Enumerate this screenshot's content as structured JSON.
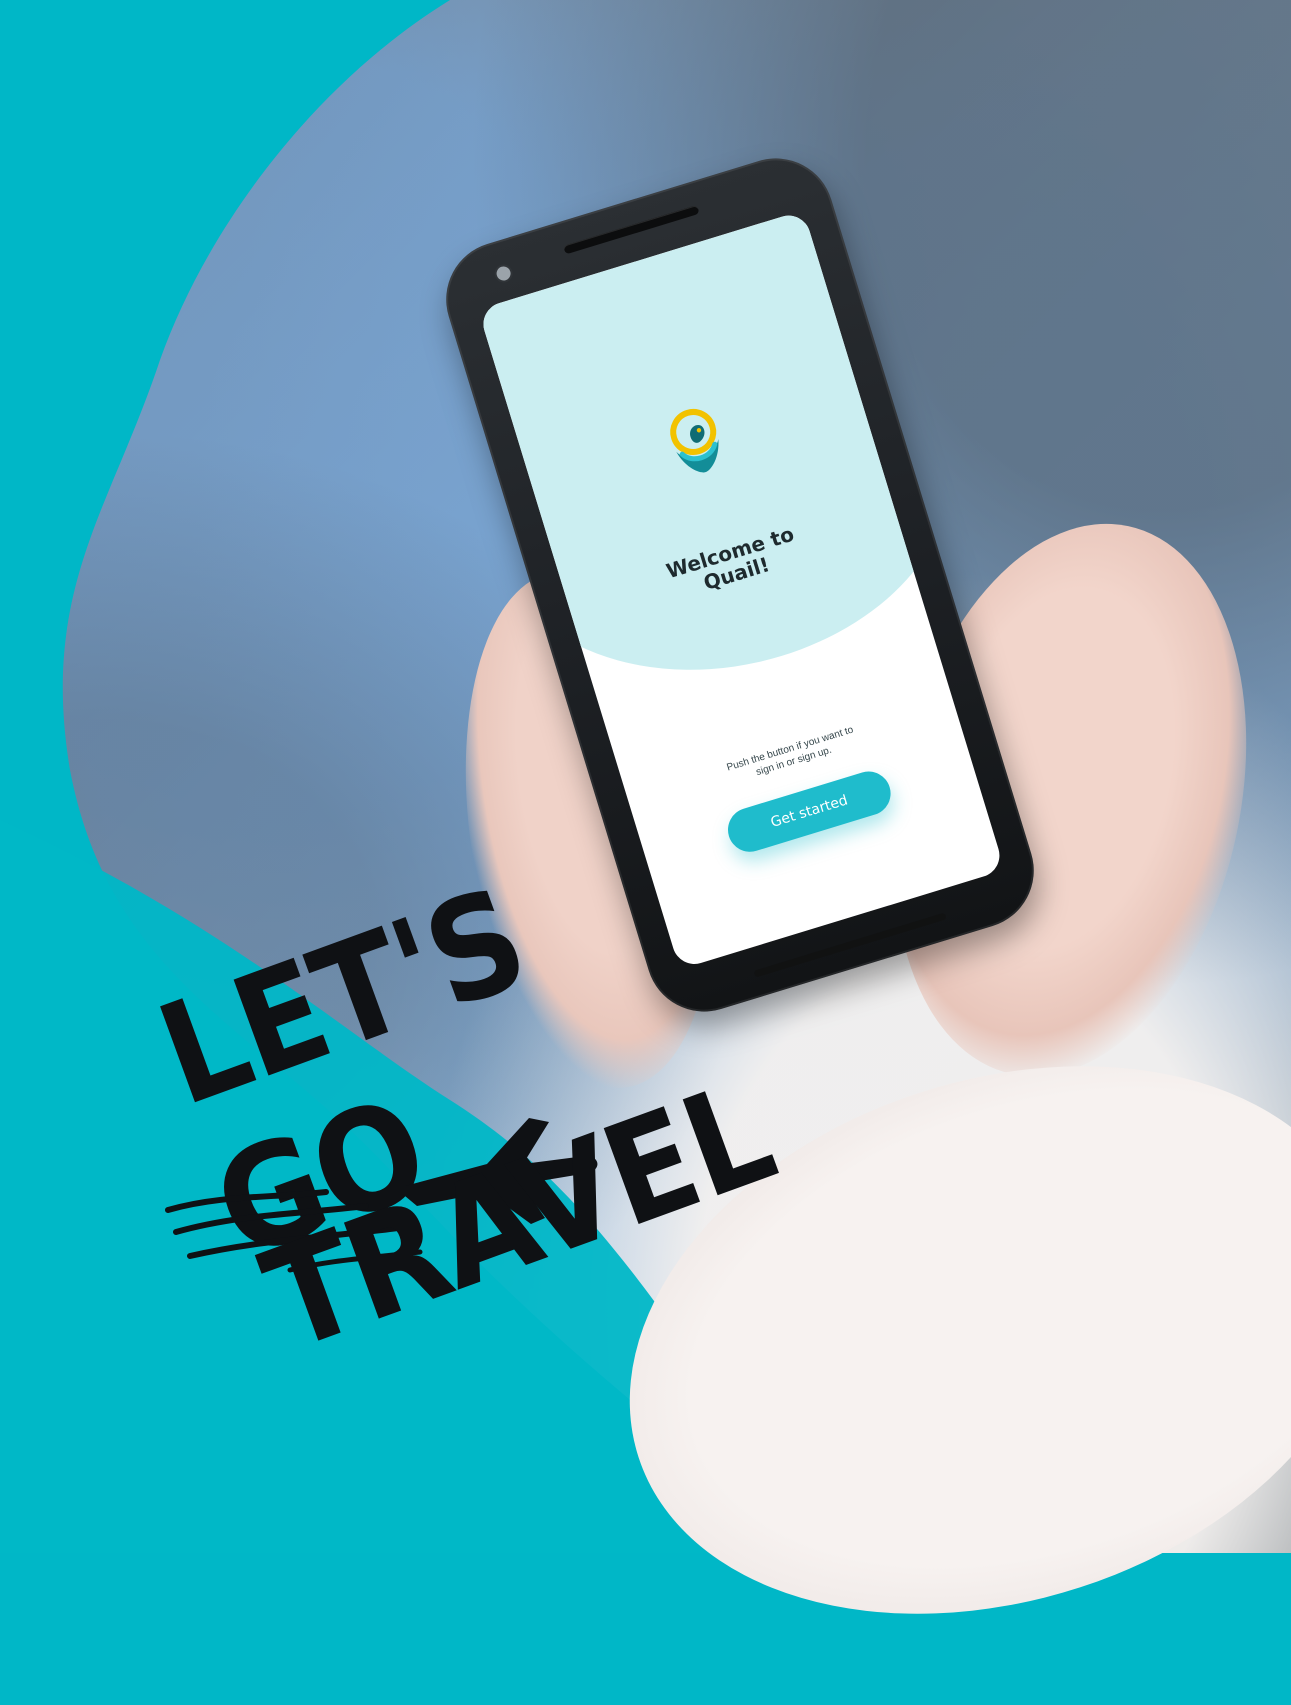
{
  "colors": {
    "teal_background": "#00b7c7",
    "screen_blob": "#cbeef1",
    "cta_button": "#1fbccc",
    "logo_teal": "#138d98",
    "logo_yellow": "#f2c200",
    "lettering": "#0f1114"
  },
  "phone": {
    "app": {
      "welcome_title": "Welcome to\nQuail!",
      "instruction_text": "Push the button if you want to\nsign in or sign up.",
      "cta_label": "Get started"
    },
    "icons": {
      "logo_icon": "quail-logo-icon",
      "camera_icon": "front-camera-icon",
      "speaker_icon": "earpiece-speaker-icon"
    }
  },
  "overlay": {
    "line1": "LET'S GO",
    "line2": "TRAVEL",
    "icons": {
      "plane_icon": "airplane-icon",
      "swoosh_icon": "motion-swoosh-icon"
    }
  }
}
